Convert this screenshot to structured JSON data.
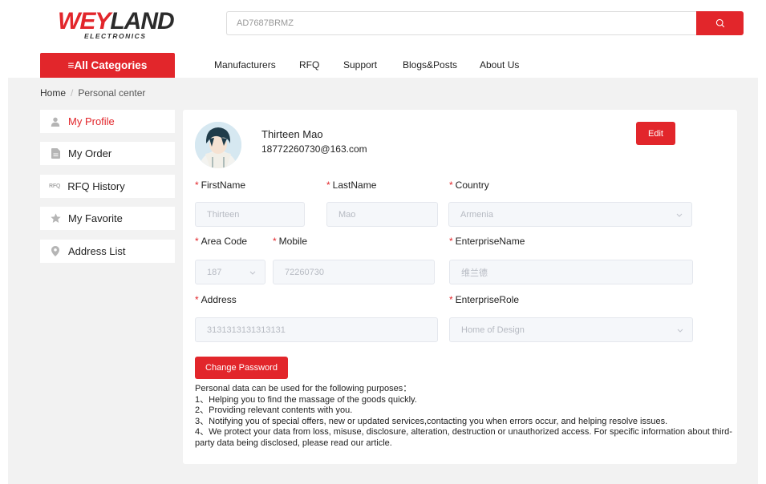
{
  "brand": {
    "logo_main_red": "WEY",
    "logo_main_dark": "LAND",
    "logo_sub": "ELECTRONICS"
  },
  "search": {
    "value": "AD7687BRMZ",
    "placeholder": ""
  },
  "nav": {
    "categories_label": "≡All Categories",
    "items": [
      "Manufacturers",
      "RFQ",
      "Support",
      "Blogs&Posts",
      "About Us"
    ]
  },
  "breadcrumb": {
    "home": "Home",
    "separator": "/",
    "current": "Personal center"
  },
  "sidebar": {
    "items": [
      {
        "label": "My Profile",
        "icon": "user-icon",
        "active": true
      },
      {
        "label": "My Order",
        "icon": "document-icon",
        "active": false
      },
      {
        "label": "RFQ History",
        "icon": "rfq-icon",
        "icon_text": "RFQ",
        "active": false
      },
      {
        "label": "My Favorite",
        "icon": "star-icon",
        "active": false
      },
      {
        "label": "Address List",
        "icon": "location-pin-icon",
        "active": false
      }
    ]
  },
  "profile": {
    "name": "Thirteen Mao",
    "email": "18772260730@163.com",
    "edit_label": "Edit"
  },
  "form": {
    "required_mark": "*",
    "firstname": {
      "label": "FirstName",
      "value": "Thirteen"
    },
    "lastname": {
      "label": "LastName",
      "value": "Mao"
    },
    "country": {
      "label": "Country",
      "value": "Armenia"
    },
    "area_code": {
      "label": "Area Code",
      "value": "187"
    },
    "mobile": {
      "label": "Mobile",
      "value": "72260730"
    },
    "enterprise_name": {
      "label": "EnterpriseName",
      "value": "维兰德"
    },
    "address": {
      "label": "Address",
      "value": "3131313131313131"
    },
    "enterprise_role": {
      "label": "EnterpriseRole",
      "value": "Home of Design"
    },
    "change_password_label": "Change Password"
  },
  "notes": [
    "Personal data can be used for the following purposes：",
    "1、Helping you to find the massage of the goods quickly.",
    "2、Providing relevant contents with you.",
    "3、Notifying you of special offers, new or updated services,contacting you when errors occur, and helping resolve issues.",
    "4、We protect your data from loss, misuse, disclosure, alteration, destruction or unauthorized access. For specific information about third-party data being disclosed, please read our article."
  ],
  "colors": {
    "accent": "#e2262b",
    "page_bg": "#f2f2f2",
    "input_bg": "#f5f7fa"
  }
}
